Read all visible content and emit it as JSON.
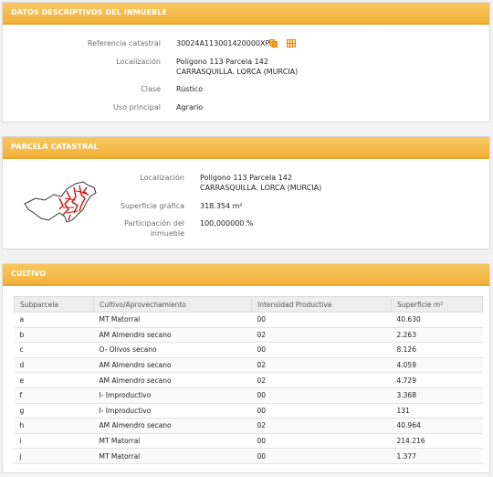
{
  "inmueble": {
    "header": "DATOS DESCRIPTIVOS DEL INMUEBLE",
    "ref_label": "Referencia catastral",
    "ref_value": "30024A113001420000XP",
    "loc_label": "Localización",
    "loc_line1": "Polígono 113 Parcela 142",
    "loc_line2": "CARRASQUILLA. LORCA (MURCIA)",
    "clase_label": "Clase",
    "clase_value": "Rústico",
    "uso_label": "Uso principal",
    "uso_value": "Agrario",
    "copy_icon": "copy-icon",
    "grid_icon": "grid-icon",
    "icon_color": "#f0a020"
  },
  "parcela": {
    "header": "PARCELA CATASTRAL",
    "loc_label": "Localización",
    "loc_line1": "Polígono 113 Parcela 142",
    "loc_line2": "CARRASQUILLA. LORCA (MURCIA)",
    "sup_label": "Superficie gráfica",
    "sup_value": "318.354 m²",
    "part_label_1": "Participación del",
    "part_label_2": "inmueble",
    "part_value": "100,000000 %"
  },
  "cultivo": {
    "header": "CULTIVO",
    "columns": [
      "Subparcela",
      "Cultivo/Aprovechamiento",
      "Intensidad Productiva",
      "Superficie m²"
    ],
    "rows": [
      [
        "a",
        "MT Matorral",
        "00",
        "40.630"
      ],
      [
        "b",
        "AM Almendro secano",
        "02",
        "2.263"
      ],
      [
        "c",
        "O- Olivos secano",
        "00",
        "8.126"
      ],
      [
        "d",
        "AM Almendro secano",
        "02",
        "4.059"
      ],
      [
        "e",
        "AM Almendro secano",
        "02",
        "4.729"
      ],
      [
        "f",
        "I- Improductivo",
        "00",
        "3.368"
      ],
      [
        "g",
        "I- Improductivo",
        "00",
        "131"
      ],
      [
        "h",
        "AM Almendro secano",
        "02",
        "40.964"
      ],
      [
        "i",
        "MT Matorral",
        "00",
        "214.216"
      ],
      [
        "j",
        "MT Matorral",
        "00",
        "1.377"
      ]
    ]
  },
  "colors": {
    "header_bg": "#f2b23c",
    "parcel_outline": "#333333",
    "parcel_lines": "#d01010"
  }
}
